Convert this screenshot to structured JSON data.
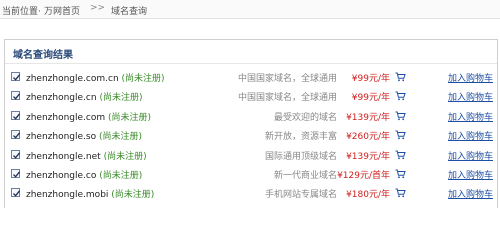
{
  "breadcrumb": {
    "current_label": "当前位置",
    "home": "万网首页",
    "separator": ">>",
    "page": "域名查询"
  },
  "results": {
    "title": "域名查询结果",
    "add_to_cart_label": "加入购物车",
    "items": [
      {
        "domain": "zhenzhongle.com.cn",
        "status": "(尚未注册)",
        "desc": "中国国家域名，全球通用",
        "price": "¥99元/年",
        "checked": true
      },
      {
        "domain": "zhenzhongle.cn",
        "status": "(尚未注册)",
        "desc": "中国国家域名，全球通用",
        "price": "¥99元/年",
        "checked": true
      },
      {
        "domain": "zhenzhongle.com",
        "status": "(尚未注册)",
        "desc": "最受欢迎的域名",
        "price": "¥139元/年",
        "checked": true
      },
      {
        "domain": "zhenzhongle.so",
        "status": "(尚未注册)",
        "desc": "新开放，资源丰富",
        "price": "¥260元/年",
        "checked": true
      },
      {
        "domain": "zhenzhongle.net",
        "status": "(尚未注册)",
        "desc": "国际通用顶级域名",
        "price": "¥139元/年",
        "checked": true
      },
      {
        "domain": "zhenzhongle.co",
        "status": "(尚未注册)",
        "desc": "新一代商业域名",
        "price": "¥129元/首年",
        "checked": true
      },
      {
        "domain": "zhenzhongle.mobi",
        "status": "(尚未注册)",
        "desc": "手机网站专属域名",
        "price": "¥180元/年",
        "checked": true
      }
    ]
  },
  "colors": {
    "status_green": "#3a8a2a",
    "price_red": "#d0201f",
    "link_blue": "#1f4fa5"
  }
}
